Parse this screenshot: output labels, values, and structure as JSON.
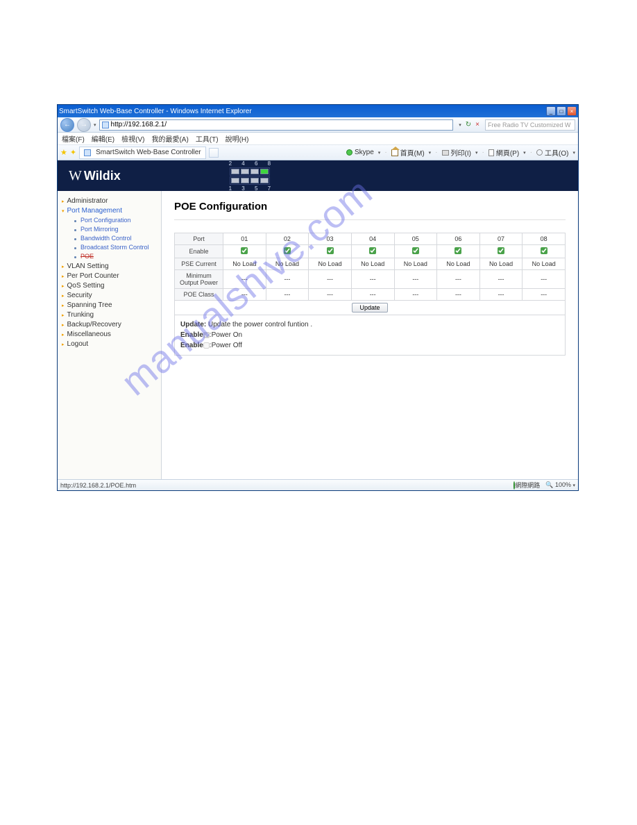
{
  "window": {
    "title": "SmartSwitch Web-Base Controller - Windows Internet Explorer"
  },
  "nav": {
    "url": "http://192.168.2.1/",
    "search_placeholder": "Free Radio TV Customized W"
  },
  "menubar": {
    "file": "檔案(F)",
    "edit": "編輯(E)",
    "view": "檢視(V)",
    "fav": "我的最愛(A)",
    "tools": "工具(T)",
    "help": "說明(H)"
  },
  "tab": {
    "title": "SmartSwitch Web-Base Controller"
  },
  "toolbar": {
    "skype": "Skype",
    "home": "首頁(M)",
    "print": "列印(I)",
    "page": "網頁(P)",
    "tools": "工具(O)"
  },
  "logo": {
    "mark": "W",
    "text": "Wildix"
  },
  "port_labels": {
    "top": "2 4 6 8",
    "bottom": "1 3 5 7"
  },
  "sidebar": {
    "admin": "Administrator",
    "portmgmt": "Port Management",
    "sub": {
      "portconf": "Port Configuration",
      "portmirror": "Port Mirroring",
      "bwcontrol": "Bandwidth Control",
      "bcast": "Broadcast Storm Control",
      "poe": "POE"
    },
    "vlan": "VLAN Setting",
    "ppc": "Per Port Counter",
    "qos": "QoS Setting",
    "sec": "Security",
    "stp": "Spanning Tree",
    "trunk": "Trunking",
    "backup": "Backup/Recovery",
    "misc": "Miscellaneous",
    "logout": "Logout"
  },
  "main": {
    "title": "POE Configuration",
    "rows": {
      "port": "Port",
      "enable": "Enable",
      "pse": "PSE Current",
      "minout": "Minimum Output Power",
      "poeclass": "POE Class"
    },
    "cols": [
      "01",
      "02",
      "03",
      "04",
      "05",
      "06",
      "07",
      "08"
    ],
    "noload": "No Load",
    "dash": "---",
    "update": "Update",
    "notes": {
      "update": "Update:",
      "update_t": " Update the power control funtion .",
      "en_on": "Enable",
      "en_on_t": ":Power On",
      "en_off": "Enable",
      "en_off_t": ":Power Off"
    }
  },
  "status": {
    "left": "http://192.168.2.1/POE.htm",
    "zone": "網際網路",
    "zoom": "100%"
  },
  "watermark": "manualshive.com"
}
